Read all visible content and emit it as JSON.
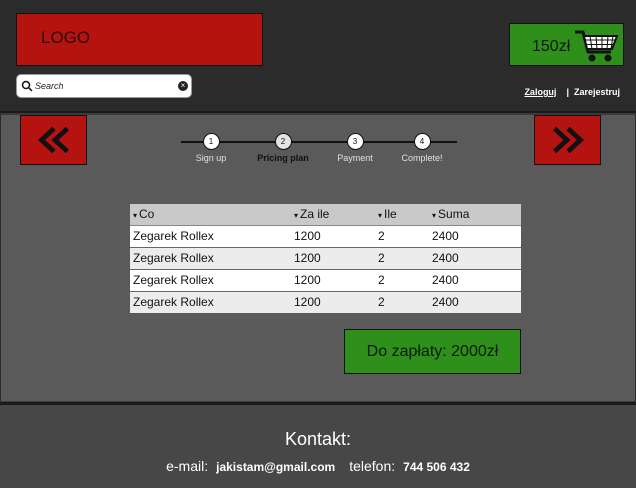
{
  "header": {
    "logo": "LOGO",
    "search": {
      "placeholder": "Search",
      "value": ""
    },
    "cart": {
      "total": "150zł",
      "icon": "shopping-cart-icon"
    },
    "auth": {
      "login": "Zaloguj",
      "separator": "|",
      "register": "Zarejestruj"
    }
  },
  "nav": {
    "prev_icon": "double-chevron-left-icon",
    "next_icon": "double-chevron-right-icon"
  },
  "steps": [
    {
      "number": "1",
      "label": "Sign up"
    },
    {
      "number": "2",
      "label": "Pricing plan"
    },
    {
      "number": "3",
      "label": "Payment"
    },
    {
      "number": "4",
      "label": "Complete!"
    }
  ],
  "active_step": 2,
  "table": {
    "sort_indicator": "▾",
    "columns": [
      "Co",
      "Za ile",
      "Ile",
      "Suma"
    ],
    "rows": [
      [
        "Zegarek Rollex",
        "1200",
        "2",
        "2400"
      ],
      [
        "Zegarek Rollex",
        "1200",
        "2",
        "2400"
      ],
      [
        "Zegarek Rollex",
        "1200",
        "2",
        "2400"
      ],
      [
        "Zegarek Rollex",
        "1200",
        "2",
        "2400"
      ]
    ]
  },
  "payment": {
    "label": "Do zapłaty: 2000zł"
  },
  "footer": {
    "title": "Kontakt:",
    "email_label": "e-mail:",
    "email": "jakistam@gmail.com",
    "phone_label": "telefon:",
    "phone": "744 506 432"
  },
  "colors": {
    "red": "#b5130f",
    "green": "#2f8f1b",
    "header_bg": "#2b2b2b",
    "main_bg": "#5a5a5a",
    "footer_bg": "#474747"
  }
}
